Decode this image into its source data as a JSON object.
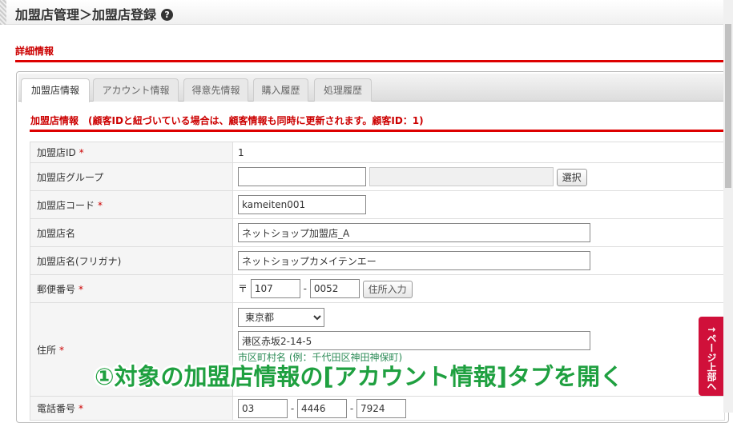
{
  "header": {
    "title": "加盟店管理＞加盟店登録",
    "help_icon": "question-circle-icon"
  },
  "section_title": "詳細情報",
  "tabs": [
    {
      "label": "加盟店情報",
      "active": true
    },
    {
      "label": "アカウント情報"
    },
    {
      "label": "得意先情報"
    },
    {
      "label": "購入履歴"
    },
    {
      "label": "処理履歴"
    }
  ],
  "subheading": "加盟店情報　(顧客IDと紐づいている場合は、顧客情報も同時に更新されます。顧客ID：1)",
  "required_mark": "*",
  "fields": {
    "id": {
      "label": "加盟店ID",
      "value": "1"
    },
    "group": {
      "label": "加盟店グループ",
      "value": "",
      "button": "選択"
    },
    "code": {
      "label": "加盟店コード",
      "value": "kameiten001"
    },
    "name": {
      "label": "加盟店名",
      "value": "ネットショップ加盟店_A"
    },
    "kana": {
      "label": "加盟店名(フリガナ)",
      "value": "ネットショップカメイテンエー"
    },
    "postal": {
      "label": "郵便番号",
      "mark": "〒",
      "p1": "107",
      "sep": "-",
      "p2": "0052",
      "button": "住所入力"
    },
    "address": {
      "label": "住所",
      "pref": "東京都",
      "city": "港区赤坂2-14-5",
      "hint": "市区町村名 (例：千代田区神田神保町)"
    },
    "phone": {
      "label": "電話番号",
      "p1": "03",
      "p2": "4446",
      "p3": "7924",
      "sep": "-"
    }
  },
  "overlay": "①対象の加盟店情報の[アカウント情報]タブを開く",
  "page_top": "↑ページ上部へ"
}
